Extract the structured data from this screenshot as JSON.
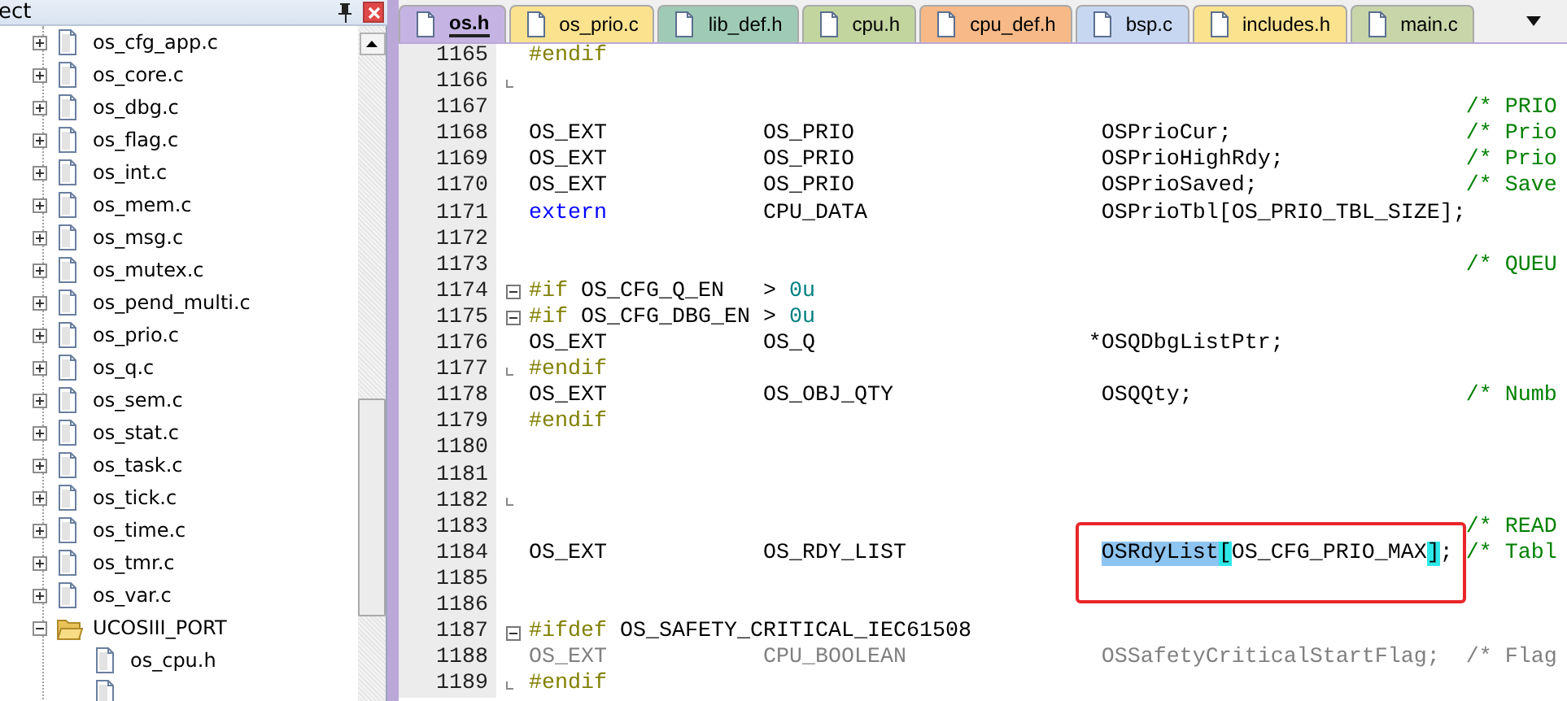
{
  "panel": {
    "title": "ect",
    "tree": [
      {
        "label": "os_cfg_app.c",
        "kind": "file",
        "expanded": false
      },
      {
        "label": "os_core.c",
        "kind": "file",
        "expanded": false
      },
      {
        "label": "os_dbg.c",
        "kind": "file",
        "expanded": false
      },
      {
        "label": "os_flag.c",
        "kind": "file",
        "expanded": false
      },
      {
        "label": "os_int.c",
        "kind": "file",
        "expanded": false
      },
      {
        "label": "os_mem.c",
        "kind": "file",
        "expanded": false
      },
      {
        "label": "os_msg.c",
        "kind": "file",
        "expanded": false
      },
      {
        "label": "os_mutex.c",
        "kind": "file",
        "expanded": false
      },
      {
        "label": "os_pend_multi.c",
        "kind": "file",
        "expanded": false
      },
      {
        "label": "os_prio.c",
        "kind": "file",
        "expanded": false
      },
      {
        "label": "os_q.c",
        "kind": "file",
        "expanded": false
      },
      {
        "label": "os_sem.c",
        "kind": "file",
        "expanded": false
      },
      {
        "label": "os_stat.c",
        "kind": "file",
        "expanded": false
      },
      {
        "label": "os_task.c",
        "kind": "file",
        "expanded": false
      },
      {
        "label": "os_tick.c",
        "kind": "file",
        "expanded": false
      },
      {
        "label": "os_time.c",
        "kind": "file",
        "expanded": false
      },
      {
        "label": "os_tmr.c",
        "kind": "file",
        "expanded": false
      },
      {
        "label": "os_var.c",
        "kind": "file",
        "expanded": false
      },
      {
        "label": "UCOSIII_PORT",
        "kind": "folder",
        "expanded": true,
        "children": [
          {
            "label": "os_cpu.h",
            "kind": "file"
          },
          {
            "kind": "file"
          }
        ]
      }
    ]
  },
  "tabs": [
    {
      "label": "os.h",
      "selected": true,
      "color": "#c5b4e3"
    },
    {
      "label": "os_prio.c",
      "selected": false,
      "color": "#fbe28f"
    },
    {
      "label": "lib_def.h",
      "selected": false,
      "color": "#9fcbb6"
    },
    {
      "label": "cpu.h",
      "selected": false,
      "color": "#c2d59e"
    },
    {
      "label": "cpu_def.h",
      "selected": false,
      "color": "#f6b987"
    },
    {
      "label": "bsp.c",
      "selected": false,
      "color": "#c7d7f1"
    },
    {
      "label": "includes.h",
      "selected": false,
      "color": "#fbe28f"
    },
    {
      "label": "main.c",
      "selected": false,
      "color": "#c8d5a9"
    }
  ],
  "editor": {
    "lines": [
      {
        "number": "1165",
        "tokens": [
          {
            "text": "#endif",
            "kind": "preproc"
          }
        ]
      },
      {
        "number": "1166",
        "fold_end": true
      },
      {
        "number": "1167",
        "tokens": [
          {
            "text": "/* PRIO",
            "kind": "column-comment"
          }
        ]
      },
      {
        "number": "1168",
        "tokens": [
          {
            "text": "OS_EXT            OS_PRIO                   OSPrioCur;                  ",
            "kind": "plain"
          },
          {
            "text": "/* Prio",
            "kind": "comment"
          }
        ]
      },
      {
        "number": "1169",
        "tokens": [
          {
            "text": "OS_EXT            OS_PRIO                   OSPrioHighRdy;              ",
            "kind": "plain"
          },
          {
            "text": "/* Prio",
            "kind": "comment"
          }
        ]
      },
      {
        "number": "1170",
        "tokens": [
          {
            "text": "OS_EXT            OS_PRIO                   OSPrioSaved;                ",
            "kind": "plain"
          },
          {
            "text": "/* Save",
            "kind": "comment"
          }
        ]
      },
      {
        "number": "1171",
        "tokens": [
          {
            "text": "extern",
            "kind": "keyword"
          },
          {
            "text": "            CPU_DATA                  OSPrioTbl[OS_PRIO_TBL_SIZE];",
            "kind": "plain"
          }
        ]
      },
      {
        "number": "1172"
      },
      {
        "number": "1173",
        "tokens": [
          {
            "text": "/* QUEU",
            "kind": "column-comment"
          }
        ]
      },
      {
        "number": "1174",
        "fold_start": true,
        "tokens": [
          {
            "text": "#if",
            "kind": "preproc"
          },
          {
            "text": " OS_CFG_Q_EN   > ",
            "kind": "plain"
          },
          {
            "text": "0u",
            "kind": "number"
          }
        ]
      },
      {
        "number": "1175",
        "fold_start": true,
        "tokens": [
          {
            "text": "#if",
            "kind": "preproc"
          },
          {
            "text": " OS_CFG_DBG_EN > ",
            "kind": "plain"
          },
          {
            "text": "0u",
            "kind": "number"
          }
        ]
      },
      {
        "number": "1176",
        "tokens": [
          {
            "text": "OS_EXT            OS_Q                     *OSQDbgListPtr;",
            "kind": "plain"
          }
        ]
      },
      {
        "number": "1177",
        "fold_end": true,
        "tokens": [
          {
            "text": "#endif",
            "kind": "preproc"
          }
        ]
      },
      {
        "number": "1178",
        "tokens": [
          {
            "text": "OS_EXT            OS_OBJ_QTY                OSQQty;                     ",
            "kind": "plain"
          },
          {
            "text": "/* Numb",
            "kind": "comment"
          }
        ]
      },
      {
        "number": "1179",
        "tokens": [
          {
            "text": "#endif",
            "kind": "preproc"
          }
        ]
      },
      {
        "number": "1180"
      },
      {
        "number": "1181"
      },
      {
        "number": "1182",
        "fold_end": true
      },
      {
        "number": "1183",
        "tokens": [
          {
            "text": "/* READ",
            "kind": "column-comment"
          }
        ]
      },
      {
        "number": "1184",
        "marked": true,
        "tokens": [
          {
            "text": "OS_EXT            OS_RDY_LIST               ",
            "kind": "plain"
          },
          {
            "text": "OSRdyList",
            "kind": "selection"
          },
          {
            "text": "[",
            "kind": "brace"
          },
          {
            "text": "OS_CFG_PRIO_MAX",
            "kind": "plain"
          },
          {
            "text": "]",
            "kind": "brace"
          },
          {
            "text": "; ",
            "kind": "plain"
          },
          {
            "text": "/* Tabl",
            "kind": "comment"
          }
        ]
      },
      {
        "number": "1185"
      },
      {
        "number": "1186"
      },
      {
        "number": "1187",
        "fold_start": true,
        "tokens": [
          {
            "text": "#ifdef",
            "kind": "preproc"
          },
          {
            "text": " OS_SAFETY_CRITICAL_IEC61508",
            "kind": "plain"
          }
        ]
      },
      {
        "number": "1188",
        "tokens": [
          {
            "text": "OS_EXT            CPU_BOOLEAN               OSSafetyCriticalStartFlag;  /* Flag",
            "kind": "inactive"
          }
        ]
      },
      {
        "number": "1189",
        "fold_end": true,
        "tokens": [
          {
            "text": "#endif",
            "kind": "preproc"
          }
        ]
      }
    ]
  }
}
